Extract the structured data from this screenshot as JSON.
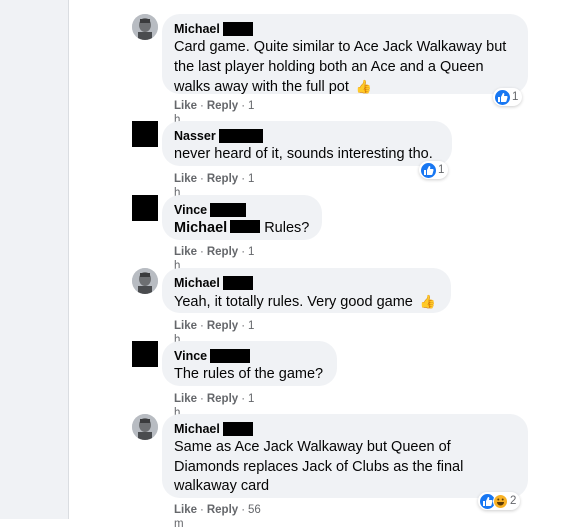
{
  "comments": [
    {
      "author": "Michael",
      "text": "Card game. Quite similar to Ace Jack Walkaway but the last player holding both an Ace and a Queen walks away with the full pot",
      "emoji": "👍",
      "like": "Like",
      "reply": "Reply",
      "time": "1 h",
      "reaction_count": "1"
    },
    {
      "author": "Nasser",
      "text": "never heard of it, sounds interesting tho.",
      "like": "Like",
      "reply": "Reply",
      "time": "1 h",
      "reaction_count": "1"
    },
    {
      "author": "Vince",
      "mention": "Michael",
      "text": "Rules?",
      "like": "Like",
      "reply": "Reply",
      "time": "1 h"
    },
    {
      "author": "Michael",
      "text": "Yeah, it totally rules. Very good game",
      "emoji": "👍",
      "like": "Like",
      "reply": "Reply",
      "time": "1 h"
    },
    {
      "author": "Vince",
      "text": "The rules of the game?",
      "like": "Like",
      "reply": "Reply",
      "time": "1 h"
    },
    {
      "author": "Michael",
      "text": "Same as Ace Jack Walkaway but Queen of Diamonds replaces Jack of Clubs as the final walkaway card",
      "like": "Like",
      "reply": "Reply",
      "time": "56 m",
      "reaction_count": "2"
    }
  ],
  "icons": {
    "like": "like-reaction-icon",
    "haha": "haha-reaction-icon",
    "thumbs_up": "thumbs-up-emoji"
  },
  "colors": {
    "bubble": "#f0f2f5",
    "meta_text": "#65676b",
    "like_blue": "#1877f2"
  }
}
